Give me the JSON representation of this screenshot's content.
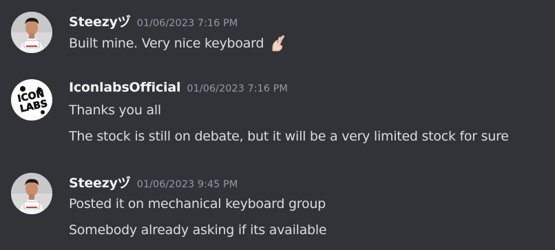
{
  "messages": [
    {
      "author": "Steezyヅ",
      "timestamp": "01/06/2023 7:16 PM",
      "avatar": "user-photo-avatar",
      "lines": [
        "Built mine. Very nice keyboard"
      ],
      "emoji": "hand-with-index-finger-and-thumb-crossed"
    },
    {
      "author": "IconlabsOfficial",
      "timestamp": "01/06/2023 7:16 PM",
      "avatar": "iconlabs-logo-avatar",
      "avatar_text": "ICON LABS",
      "lines": [
        "Thanks you all",
        "The stock is still on debate, but it will be a very limited stock for sure"
      ]
    },
    {
      "author": "Steezyヅ",
      "timestamp": "01/06/2023 9:45 PM",
      "avatar": "user-photo-avatar",
      "lines": [
        "Posted it on mechanical keyboard group",
        "Somebody already asking if its available"
      ]
    }
  ],
  "colors": {
    "background": "#313338",
    "username": "#f2f3f5",
    "text": "#dbdee1",
    "timestamp": "#949ba4"
  }
}
